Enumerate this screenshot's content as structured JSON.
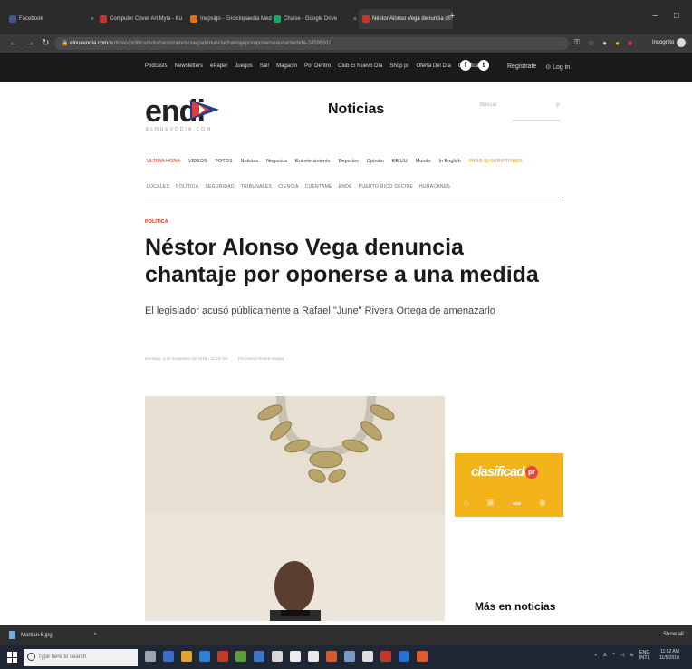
{
  "browser": {
    "tabs": [
      {
        "title": "Facebook",
        "color": "#3b5998"
      },
      {
        "title": "Computer Cover Art Myla - Ku",
        "color": "#c0392b"
      },
      {
        "title": "Inepsigo - Enciclopaedia Med",
        "color": "#e07020"
      },
      {
        "title": "Chaise - Google Drive",
        "color": "#1fa463"
      },
      {
        "title": "Néstor Alonso Vega denuncia ch",
        "color": "#c0392b",
        "active": true
      }
    ],
    "new_tab": "+",
    "url_host": "elnuevodia.com",
    "url_path": "/noticias/politica/nota/nestoralonsovegadenunciachantajeporoponerseaunamedida-2459591/",
    "profile_label": "Incognito"
  },
  "site_nav": {
    "links": [
      "Podcasts",
      "Newsletters",
      "ePaper",
      "Juegos",
      "Sal!",
      "Magacín",
      "Por Dentro",
      "Club El Nuevo Día",
      "Shop pr",
      "Oferta Del Día",
      "Clasificados"
    ],
    "social": [
      "f",
      "t"
    ],
    "register": "Regístrate",
    "login": "Log in"
  },
  "header": {
    "logo": "endi",
    "logo_sub": "ELNUEVODIA.COM",
    "section": "Noticias",
    "search_placeholder": "Buscar"
  },
  "main_nav": {
    "items": [
      "ULTIMA HORA",
      "VIDEOS",
      "FOTOS",
      "Noticias",
      "Negocios",
      "Entretenimiento",
      "Deportes",
      "Opinión",
      "EE.UU",
      "Mundo",
      "In English",
      "PARA SUSCRIPTORES"
    ],
    "sub_items": [
      "LOCALES",
      "POLÍTICA",
      "SEGURIDAD",
      "TRIBUNALES",
      "CIENCIA",
      "CUENTAME",
      "ENDE",
      "PUERTO RICO DECIDE",
      "HURACANES"
    ]
  },
  "article": {
    "kicker": "POLÍTICA",
    "headline": "Néstor Alonso Vega denuncia chantaje por oponerse a una medida",
    "subhead": "El legislador acusó públicamente a Rafael \"June\" Rivera Ortega de amenazarlo",
    "date": "domingo, 4 de noviembre de 2018 - 11:23 AM",
    "author": "Por Daniel Rivera Vargas"
  },
  "ad": {
    "brand": "clasificados",
    "badge": "pr",
    "color": "#f3b41b"
  },
  "sidebar": {
    "more_news": "Más en noticias"
  },
  "downloads": {
    "file": "Martian 6.jpg",
    "show_all": "Show all"
  },
  "taskbar": {
    "search_placeholder": "Type here to search",
    "lang": "ENG",
    "region": "INTL",
    "time": "11:52 AM",
    "date": "11/5/2018"
  }
}
